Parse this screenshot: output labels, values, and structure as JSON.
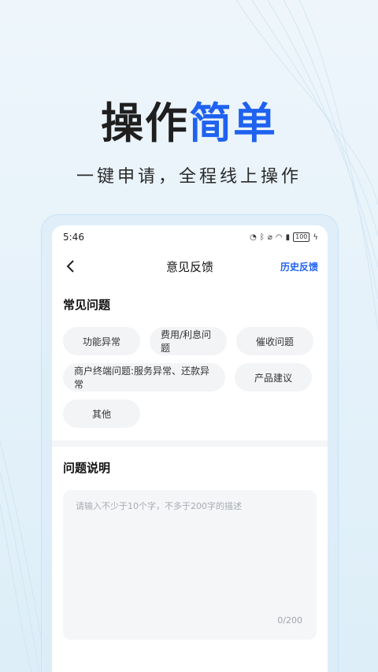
{
  "hero": {
    "title_dark": "操作",
    "title_blue": "简单",
    "subtitle": "一键申请，全程线上操作"
  },
  "status_bar": {
    "time": "5:46",
    "battery": "100"
  },
  "nav": {
    "title": "意见反馈",
    "history_link": "历史反馈"
  },
  "faq": {
    "title": "常见问题",
    "chips": [
      "功能异常",
      "费用/利息问题",
      "催收问题",
      "商户终端问题:服务异常、还款异常",
      "产品建议",
      "其他"
    ]
  },
  "description": {
    "title": "问题说明",
    "placeholder": "请输入不少于10个字，不多于200字的描述",
    "value": "",
    "counter": "0/200"
  },
  "colors": {
    "accent": "#1f62f0",
    "chip_bg": "#f3f4f6",
    "page_bg": "#e6f2fa"
  }
}
